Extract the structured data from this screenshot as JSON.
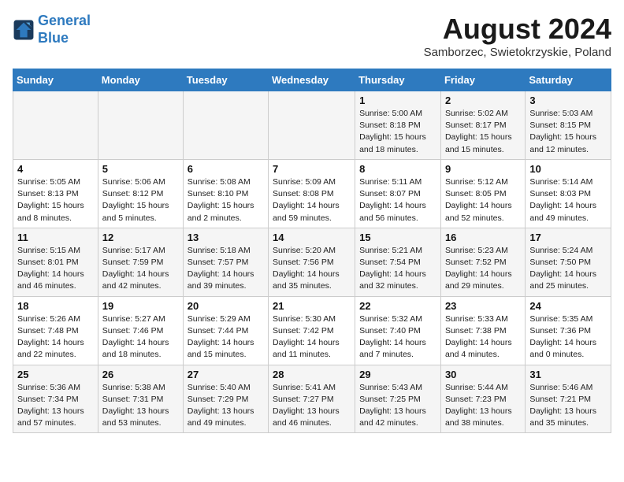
{
  "header": {
    "logo_line1": "General",
    "logo_line2": "Blue",
    "month_year": "August 2024",
    "location": "Samborzec, Swietokrzyskie, Poland"
  },
  "days_of_week": [
    "Sunday",
    "Monday",
    "Tuesday",
    "Wednesday",
    "Thursday",
    "Friday",
    "Saturday"
  ],
  "weeks": [
    [
      {
        "day": "",
        "info": ""
      },
      {
        "day": "",
        "info": ""
      },
      {
        "day": "",
        "info": ""
      },
      {
        "day": "",
        "info": ""
      },
      {
        "day": "1",
        "info": "Sunrise: 5:00 AM\nSunset: 8:18 PM\nDaylight: 15 hours\nand 18 minutes."
      },
      {
        "day": "2",
        "info": "Sunrise: 5:02 AM\nSunset: 8:17 PM\nDaylight: 15 hours\nand 15 minutes."
      },
      {
        "day": "3",
        "info": "Sunrise: 5:03 AM\nSunset: 8:15 PM\nDaylight: 15 hours\nand 12 minutes."
      }
    ],
    [
      {
        "day": "4",
        "info": "Sunrise: 5:05 AM\nSunset: 8:13 PM\nDaylight: 15 hours\nand 8 minutes."
      },
      {
        "day": "5",
        "info": "Sunrise: 5:06 AM\nSunset: 8:12 PM\nDaylight: 15 hours\nand 5 minutes."
      },
      {
        "day": "6",
        "info": "Sunrise: 5:08 AM\nSunset: 8:10 PM\nDaylight: 15 hours\nand 2 minutes."
      },
      {
        "day": "7",
        "info": "Sunrise: 5:09 AM\nSunset: 8:08 PM\nDaylight: 14 hours\nand 59 minutes."
      },
      {
        "day": "8",
        "info": "Sunrise: 5:11 AM\nSunset: 8:07 PM\nDaylight: 14 hours\nand 56 minutes."
      },
      {
        "day": "9",
        "info": "Sunrise: 5:12 AM\nSunset: 8:05 PM\nDaylight: 14 hours\nand 52 minutes."
      },
      {
        "day": "10",
        "info": "Sunrise: 5:14 AM\nSunset: 8:03 PM\nDaylight: 14 hours\nand 49 minutes."
      }
    ],
    [
      {
        "day": "11",
        "info": "Sunrise: 5:15 AM\nSunset: 8:01 PM\nDaylight: 14 hours\nand 46 minutes."
      },
      {
        "day": "12",
        "info": "Sunrise: 5:17 AM\nSunset: 7:59 PM\nDaylight: 14 hours\nand 42 minutes."
      },
      {
        "day": "13",
        "info": "Sunrise: 5:18 AM\nSunset: 7:57 PM\nDaylight: 14 hours\nand 39 minutes."
      },
      {
        "day": "14",
        "info": "Sunrise: 5:20 AM\nSunset: 7:56 PM\nDaylight: 14 hours\nand 35 minutes."
      },
      {
        "day": "15",
        "info": "Sunrise: 5:21 AM\nSunset: 7:54 PM\nDaylight: 14 hours\nand 32 minutes."
      },
      {
        "day": "16",
        "info": "Sunrise: 5:23 AM\nSunset: 7:52 PM\nDaylight: 14 hours\nand 29 minutes."
      },
      {
        "day": "17",
        "info": "Sunrise: 5:24 AM\nSunset: 7:50 PM\nDaylight: 14 hours\nand 25 minutes."
      }
    ],
    [
      {
        "day": "18",
        "info": "Sunrise: 5:26 AM\nSunset: 7:48 PM\nDaylight: 14 hours\nand 22 minutes."
      },
      {
        "day": "19",
        "info": "Sunrise: 5:27 AM\nSunset: 7:46 PM\nDaylight: 14 hours\nand 18 minutes."
      },
      {
        "day": "20",
        "info": "Sunrise: 5:29 AM\nSunset: 7:44 PM\nDaylight: 14 hours\nand 15 minutes."
      },
      {
        "day": "21",
        "info": "Sunrise: 5:30 AM\nSunset: 7:42 PM\nDaylight: 14 hours\nand 11 minutes."
      },
      {
        "day": "22",
        "info": "Sunrise: 5:32 AM\nSunset: 7:40 PM\nDaylight: 14 hours\nand 7 minutes."
      },
      {
        "day": "23",
        "info": "Sunrise: 5:33 AM\nSunset: 7:38 PM\nDaylight: 14 hours\nand 4 minutes."
      },
      {
        "day": "24",
        "info": "Sunrise: 5:35 AM\nSunset: 7:36 PM\nDaylight: 14 hours\nand 0 minutes."
      }
    ],
    [
      {
        "day": "25",
        "info": "Sunrise: 5:36 AM\nSunset: 7:34 PM\nDaylight: 13 hours\nand 57 minutes."
      },
      {
        "day": "26",
        "info": "Sunrise: 5:38 AM\nSunset: 7:31 PM\nDaylight: 13 hours\nand 53 minutes."
      },
      {
        "day": "27",
        "info": "Sunrise: 5:40 AM\nSunset: 7:29 PM\nDaylight: 13 hours\nand 49 minutes."
      },
      {
        "day": "28",
        "info": "Sunrise: 5:41 AM\nSunset: 7:27 PM\nDaylight: 13 hours\nand 46 minutes."
      },
      {
        "day": "29",
        "info": "Sunrise: 5:43 AM\nSunset: 7:25 PM\nDaylight: 13 hours\nand 42 minutes."
      },
      {
        "day": "30",
        "info": "Sunrise: 5:44 AM\nSunset: 7:23 PM\nDaylight: 13 hours\nand 38 minutes."
      },
      {
        "day": "31",
        "info": "Sunrise: 5:46 AM\nSunset: 7:21 PM\nDaylight: 13 hours\nand 35 minutes."
      }
    ]
  ]
}
